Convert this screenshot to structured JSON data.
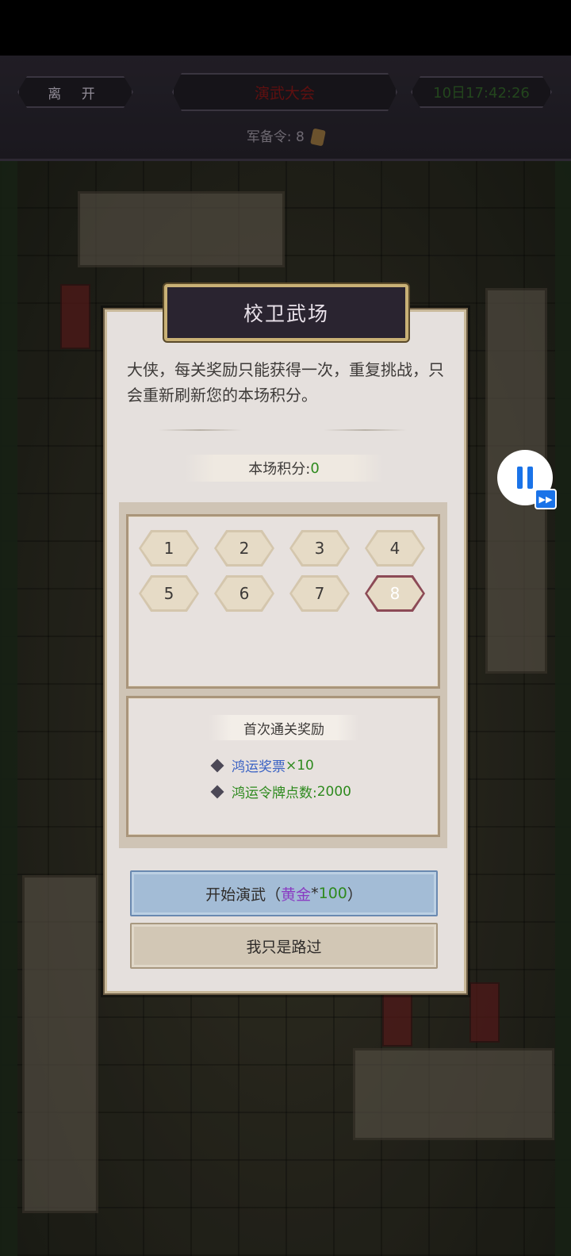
{
  "header": {
    "leave_label": "离 开",
    "title": "演武大会",
    "time": "10日17:42:26",
    "ration_label": "军备令:",
    "ration_value": "8"
  },
  "modal": {
    "title": "校卫武场",
    "description": "大侠，每关奖励只能获得一次，重复挑战，只会重新刷新您的本场积分。",
    "score_label": "本场积分:",
    "score_value": "0",
    "levels": [
      "1",
      "2",
      "3",
      "4",
      "5",
      "6",
      "7",
      "8"
    ],
    "active_level": "8",
    "reward_title": "首次通关奖励",
    "rewards": [
      {
        "name": "鸿运奖票",
        "amount": "×10"
      },
      {
        "name": "鸿运令牌点数:",
        "amount": "2000"
      }
    ],
    "start_button": {
      "prefix": "开始演武（",
      "currency": "黄金",
      "multiplier": "*",
      "cost": "100",
      "suffix": "）"
    },
    "pass_button": "我只是路过"
  },
  "overlay": {
    "pause_icon": "pause-icon",
    "fast_forward_icon": "fast-forward-icon"
  }
}
